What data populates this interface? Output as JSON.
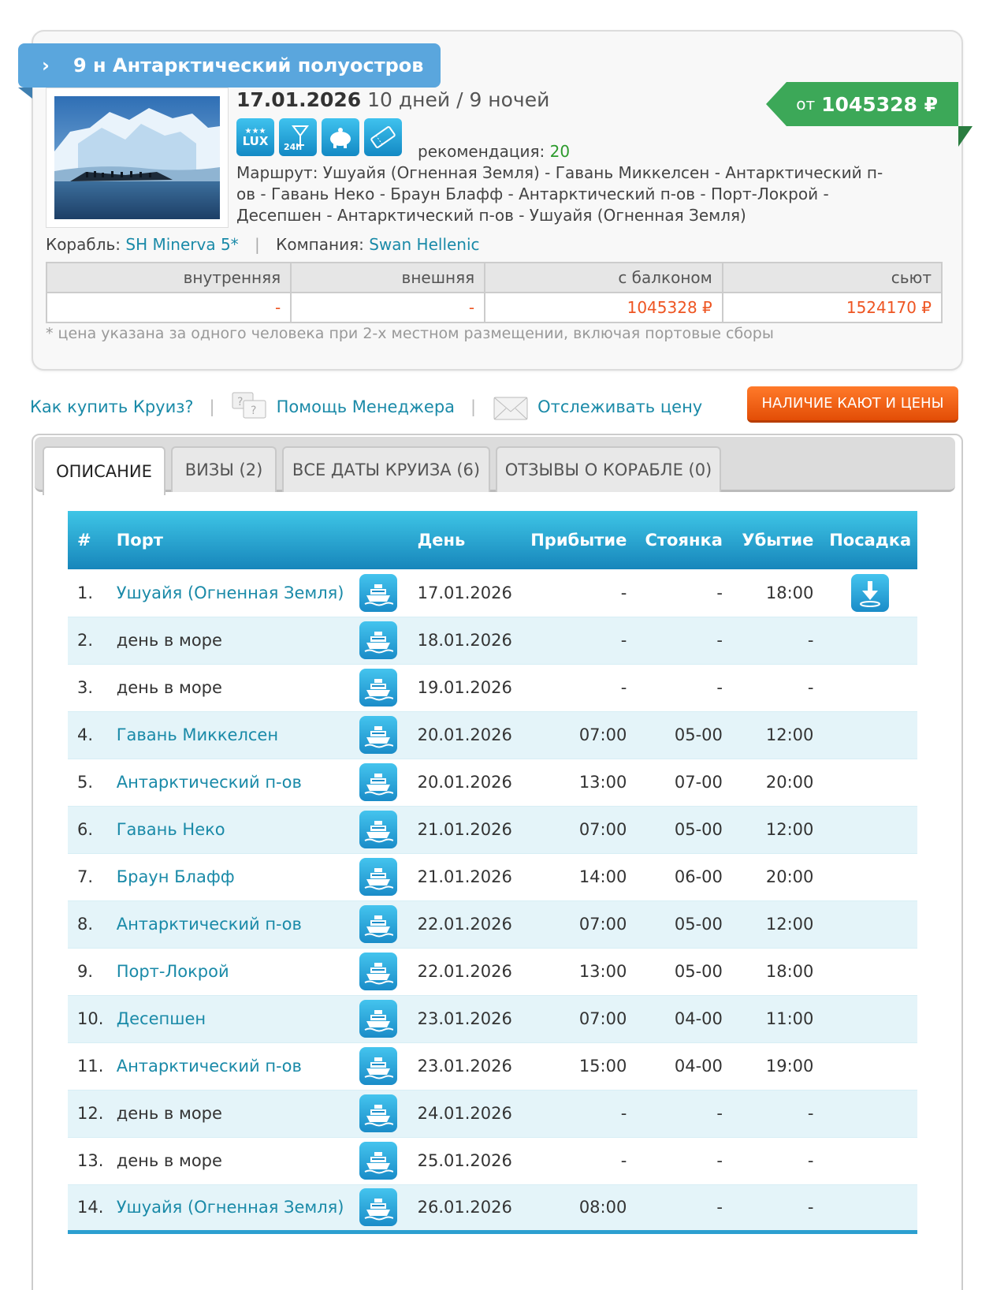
{
  "cruise": {
    "title": "9 н Антарктический полуостров",
    "date": "17.01.2026",
    "duration": "10 дней / 9 ночей",
    "recommendation_label": "рекомендация:",
    "recommendation_value": "20",
    "route_label": "Маршрут:",
    "route": "Ушуайя (Огненная Земля) - Гавань Миккелсен - Антарктический п-ов - Гавань Неко - Браун Блафф - Антарктический п-ов - Порт-Локрой - Десепшен - Антарктический п-ов - Ушуайя (Огненная Земля)",
    "ship_label": "Корабль:",
    "ship": "SH Minerva 5*",
    "company_label": "Компания:",
    "company": "Swan Hellenic",
    "price_prefix": "от",
    "price": "1045328 ₽",
    "icons": [
      {
        "name": "lux-icon",
        "text": "LUX"
      },
      {
        "name": "bar-24h-icon",
        "text": "24h"
      },
      {
        "name": "piggy-bank-icon",
        "text": ""
      },
      {
        "name": "ticket-icon",
        "text": ""
      }
    ]
  },
  "price_table": {
    "headers": [
      "внутренняя",
      "внешняя",
      "с балконом",
      "сьют"
    ],
    "values": [
      "-",
      "-",
      "1045328 ₽",
      "1524170 ₽"
    ],
    "note": "* цена указана за одного человека при 2-х местном размещении, включая портовые сборы"
  },
  "links": {
    "how_to_buy": "Как купить Круиз?",
    "manager_help": "Помощь Менеджера",
    "track_price": "Отслеживать цену",
    "availability_button": "НАЛИЧИЕ КАЮТ И ЦЕНЫ"
  },
  "tabs": [
    {
      "label": "ОПИСАНИЕ",
      "active": true
    },
    {
      "label": "ВИЗЫ (2)",
      "active": false
    },
    {
      "label": "ВСЕ ДАТЫ КРУИЗА (6)",
      "active": false
    },
    {
      "label": "ОТЗЫВЫ О КОРАБЛЕ (0)",
      "active": false
    }
  ],
  "itinerary": {
    "headers": {
      "num": "#",
      "port": "Порт",
      "day": "День",
      "arrival": "Прибытие",
      "stay": "Стоянка",
      "departure": "Убытие",
      "boarding": "Посадка"
    },
    "rows": [
      {
        "num": "1.",
        "port": "Ушуайя (Огненная Земля)",
        "link": true,
        "day": "17.01.2026",
        "arrival": "-",
        "stay": "-",
        "departure": "18:00",
        "boarding": true
      },
      {
        "num": "2.",
        "port": "день в море",
        "link": false,
        "day": "18.01.2026",
        "arrival": "-",
        "stay": "-",
        "departure": "-",
        "boarding": false
      },
      {
        "num": "3.",
        "port": "день в море",
        "link": false,
        "day": "19.01.2026",
        "arrival": "-",
        "stay": "-",
        "departure": "-",
        "boarding": false
      },
      {
        "num": "4.",
        "port": "Гавань Миккелсен",
        "link": true,
        "day": "20.01.2026",
        "arrival": "07:00",
        "stay": "05-00",
        "departure": "12:00",
        "boarding": false
      },
      {
        "num": "5.",
        "port": "Антарктический п-ов",
        "link": true,
        "day": "20.01.2026",
        "arrival": "13:00",
        "stay": "07-00",
        "departure": "20:00",
        "boarding": false
      },
      {
        "num": "6.",
        "port": "Гавань Неко",
        "link": true,
        "day": "21.01.2026",
        "arrival": "07:00",
        "stay": "05-00",
        "departure": "12:00",
        "boarding": false
      },
      {
        "num": "7.",
        "port": "Браун Блафф",
        "link": true,
        "day": "21.01.2026",
        "arrival": "14:00",
        "stay": "06-00",
        "departure": "20:00",
        "boarding": false
      },
      {
        "num": "8.",
        "port": "Антарктический п-ов",
        "link": true,
        "day": "22.01.2026",
        "arrival": "07:00",
        "stay": "05-00",
        "departure": "12:00",
        "boarding": false
      },
      {
        "num": "9.",
        "port": "Порт-Локрой",
        "link": true,
        "day": "22.01.2026",
        "arrival": "13:00",
        "stay": "05-00",
        "departure": "18:00",
        "boarding": false
      },
      {
        "num": "10.",
        "port": "Десепшен",
        "link": true,
        "day": "23.01.2026",
        "arrival": "07:00",
        "stay": "04-00",
        "departure": "11:00",
        "boarding": false
      },
      {
        "num": "11.",
        "port": "Антарктический п-ов",
        "link": true,
        "day": "23.01.2026",
        "arrival": "15:00",
        "stay": "04-00",
        "departure": "19:00",
        "boarding": false
      },
      {
        "num": "12.",
        "port": "день в море",
        "link": false,
        "day": "24.01.2026",
        "arrival": "-",
        "stay": "-",
        "departure": "-",
        "boarding": false
      },
      {
        "num": "13.",
        "port": "день в море",
        "link": false,
        "day": "25.01.2026",
        "arrival": "-",
        "stay": "-",
        "departure": "-",
        "boarding": false
      },
      {
        "num": "14.",
        "port": "Ушуайя (Огненная Земля)",
        "link": true,
        "day": "26.01.2026",
        "arrival": "08:00",
        "stay": "-",
        "departure": "-",
        "boarding": false
      }
    ]
  },
  "colors": {
    "accent": "#1a8aa8",
    "price_green": "#3ca858",
    "price_red": "#ee5522",
    "button_orange": "#f26a17",
    "header_blue": "#2aa6d6"
  }
}
